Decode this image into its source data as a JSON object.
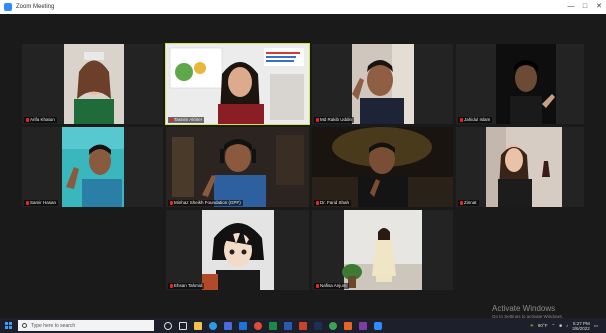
{
  "window": {
    "title": "Zoom Meeting"
  },
  "participants": [
    {
      "name": "Arifa Khatun"
    },
    {
      "name": "Tasnim Akhter"
    },
    {
      "name": "Md Rakib Uddin"
    },
    {
      "name": "Jahidul Islam"
    },
    {
      "name": "Samir Hasan"
    },
    {
      "name": "Minhaz Sheikh Foundation (GPF)"
    },
    {
      "name": "Dr. Farid Shah"
    },
    {
      "name": "Zinnat"
    },
    {
      "name": "Ehsan Tahmid"
    },
    {
      "name": "Nafisa Anjum"
    }
  ],
  "watermark": {
    "line1": "Activate Windows",
    "line2": "Go to Settings to activate Windows."
  },
  "taskbar": {
    "search_placeholder": "Type here to search",
    "weather": "80°F",
    "time": "5:27 PM",
    "date": "3/6/2022"
  },
  "icons": {
    "start": "windows-start-icon",
    "search": "search-icon",
    "mic_muted": "mic-muted-icon"
  }
}
